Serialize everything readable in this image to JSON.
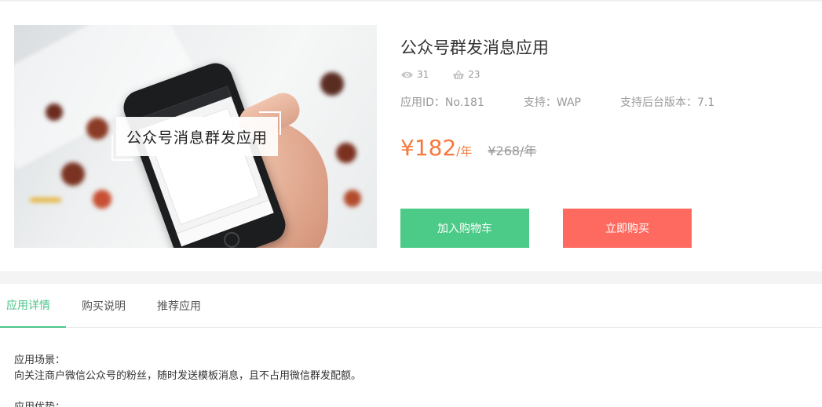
{
  "product": {
    "title": "公众号群发消息应用",
    "image_caption": "公众号消息群发应用",
    "views": "31",
    "purchases": "23",
    "app_id": "应用ID：No.181",
    "support": "支持：WAP",
    "backend_version": "支持后台版本：7.1",
    "price": "¥182",
    "price_unit": "/年",
    "original_price": "¥268/年"
  },
  "actions": {
    "add_to_cart": "加入购物车",
    "buy_now": "立即购买"
  },
  "tabs": [
    {
      "label": "应用详情",
      "active": true
    },
    {
      "label": "购买说明",
      "active": false
    },
    {
      "label": "推荐应用",
      "active": false
    }
  ],
  "details": {
    "scene_heading": "应用场景：",
    "scene_text": "向关注商户微信公众号的粉丝，随时发送模板消息，且不占用微信群发配额。",
    "advantage_heading": "应用优势："
  },
  "colors": {
    "accent_green": "#4cca87",
    "accent_red": "#fe6a5f",
    "price_orange": "#f7783c"
  },
  "icons": {
    "views": "eye-icon",
    "purchases": "basket-icon"
  }
}
